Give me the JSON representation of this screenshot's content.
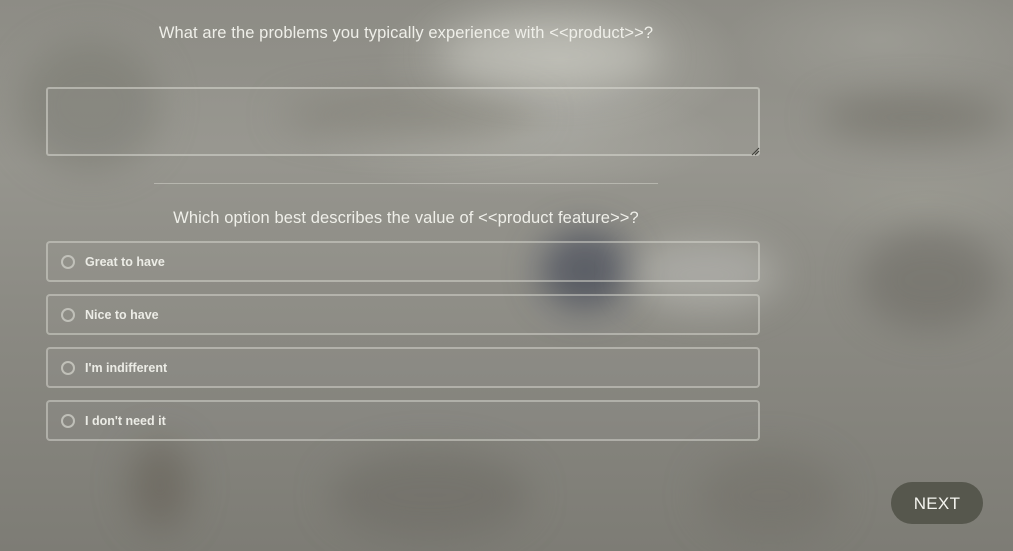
{
  "survey": {
    "question_1": {
      "title": "What are the problems you typically experience with <<product>>?",
      "answer_value": ""
    },
    "question_2": {
      "title": "Which option best describes the value of <<product feature>>?",
      "options": [
        {
          "label": "Great to have"
        },
        {
          "label": "Nice to have"
        },
        {
          "label": "I'm indifferent"
        },
        {
          "label": "I don't need it"
        }
      ]
    },
    "next_label": "NEXT"
  },
  "colors": {
    "background": "#8c8b84",
    "next_button": "#56574d",
    "text": "#efefe9"
  }
}
